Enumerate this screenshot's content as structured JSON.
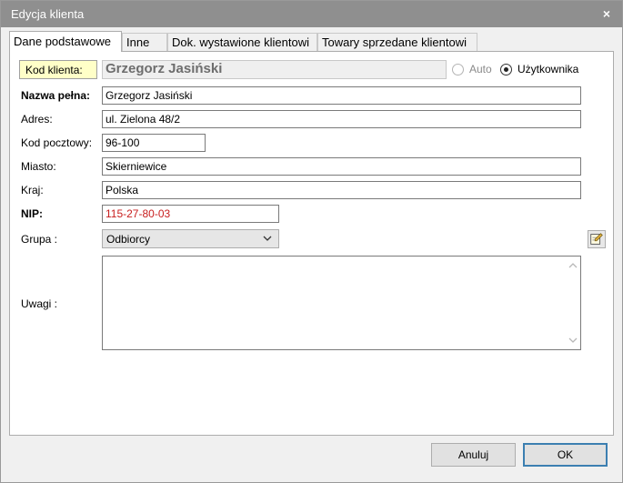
{
  "window": {
    "title": "Edycja klienta",
    "close_glyph": "×"
  },
  "tabs": [
    {
      "label": "Dane podstawowe",
      "active": true
    },
    {
      "label": "Inne",
      "active": false
    },
    {
      "label": "Dok. wystawione klientowi",
      "active": false
    },
    {
      "label": "Towary sprzedane klientowi",
      "active": false
    }
  ],
  "form": {
    "kod_label": "Kod klienta:",
    "kod_value": "Grzegorz Jasiński",
    "radio_auto": "Auto",
    "radio_user": "Użytkownika",
    "radio_selected": "Użytkownika",
    "nazwa_label": "Nazwa pełna:",
    "nazwa_value": "Grzegorz Jasiński",
    "adres_label": "Adres:",
    "adres_value": "ul. Zielona 48/2",
    "kod_pocztowy_label": "Kod pocztowy:",
    "kod_pocztowy_value": "96-100",
    "miasto_label": "Miasto:",
    "miasto_value": "Skierniewice",
    "kraj_label": "Kraj:",
    "kraj_value": "Polska",
    "nip_label": "NIP:",
    "nip_value": "115-27-80-03",
    "grupa_label": "Grupa :",
    "grupa_value": "Odbiorcy",
    "uwagi_label": "Uwagi :",
    "uwagi_value": ""
  },
  "buttons": {
    "cancel_label": "Anuluj",
    "ok_label": "OK"
  },
  "icons": {
    "close": "close-icon",
    "dropdown": "chevron-down-icon",
    "edit": "edit-note-icon"
  },
  "colors": {
    "titlebar": "#8f8f8f",
    "kod_label_bg": "#ffffc8",
    "nip_text": "#c81e1e",
    "default_button_border": "#3c7fb1"
  }
}
